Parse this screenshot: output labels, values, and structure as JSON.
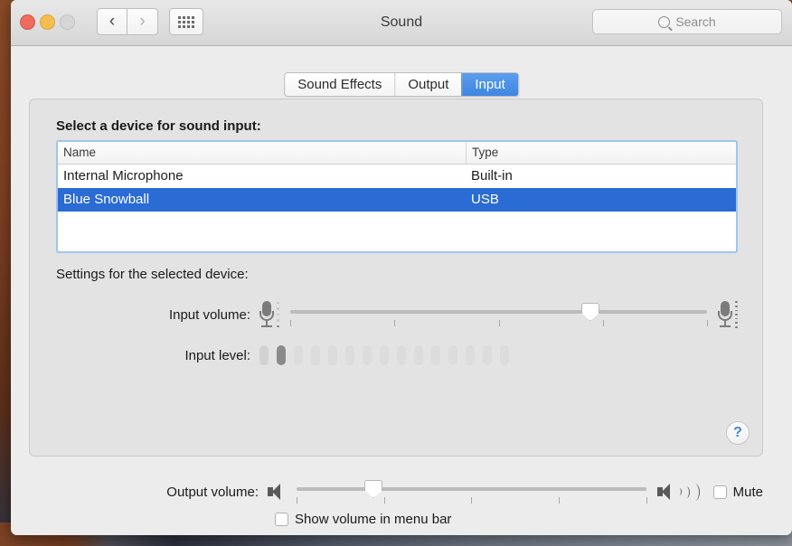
{
  "window": {
    "title": "Sound",
    "traffic_lights": [
      {
        "name": "close",
        "color": "#ed6b5f"
      },
      {
        "name": "minimize",
        "color": "#f5bd4f"
      },
      {
        "name": "zoom",
        "color": "#d6d6d6"
      }
    ],
    "nav": {
      "back": "‹",
      "forward": "›"
    },
    "search": {
      "placeholder": "Search",
      "value": ""
    }
  },
  "tabs": [
    {
      "label": "Sound Effects",
      "active": false
    },
    {
      "label": "Output",
      "active": false
    },
    {
      "label": "Input",
      "active": true
    }
  ],
  "panel": {
    "heading": "Select a device for sound input:",
    "settings_heading": "Settings for the selected device:",
    "table": {
      "columns": [
        "Name",
        "Type"
      ],
      "rows": [
        {
          "name": "Internal Microphone",
          "type": "Built-in",
          "selected": false
        },
        {
          "name": "Blue Snowball",
          "type": "USB",
          "selected": true
        }
      ]
    },
    "input_volume": {
      "label": "Input volume:",
      "value_percent": 72,
      "tick_count": 5
    },
    "input_level": {
      "label": "Input level:",
      "segment_count": 15,
      "active_segments": 2
    },
    "help_button": "?"
  },
  "footer": {
    "output_volume": {
      "label": "Output volume:",
      "value_percent": 22,
      "tick_count": 5
    },
    "mute": {
      "label": "Mute",
      "checked": false
    },
    "show_volume_menu_bar": {
      "label": "Show volume in menu bar",
      "checked": false
    }
  },
  "colors": {
    "accent_blue": "#2a6bd4",
    "tab_active": "#3d86e0",
    "window_bg": "#ececec",
    "panel_bg": "#e3e3e3",
    "focus_ring": "#9fc4ef"
  }
}
